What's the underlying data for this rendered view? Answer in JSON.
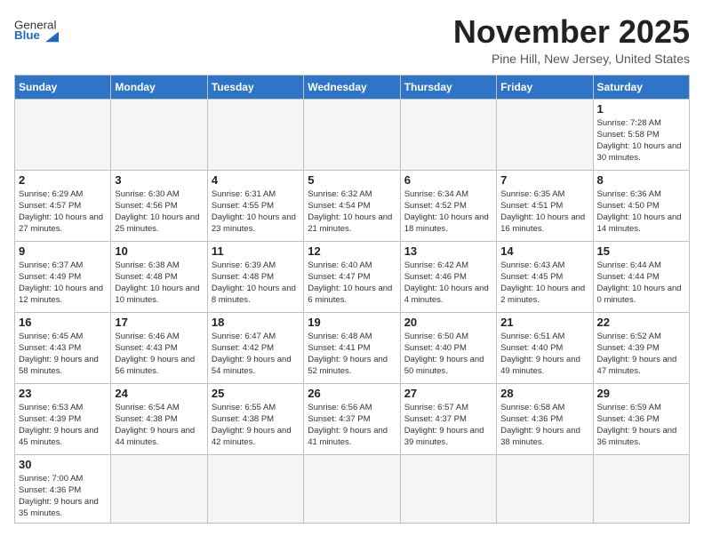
{
  "header": {
    "logo_general": "General",
    "logo_blue": "Blue",
    "title": "November 2025",
    "location": "Pine Hill, New Jersey, United States"
  },
  "days_of_week": [
    "Sunday",
    "Monday",
    "Tuesday",
    "Wednesday",
    "Thursday",
    "Friday",
    "Saturday"
  ],
  "weeks": [
    [
      {
        "day": "",
        "info": ""
      },
      {
        "day": "",
        "info": ""
      },
      {
        "day": "",
        "info": ""
      },
      {
        "day": "",
        "info": ""
      },
      {
        "day": "",
        "info": ""
      },
      {
        "day": "",
        "info": ""
      },
      {
        "day": "1",
        "info": "Sunrise: 7:28 AM\nSunset: 5:58 PM\nDaylight: 10 hours and 30 minutes."
      }
    ],
    [
      {
        "day": "2",
        "info": "Sunrise: 6:29 AM\nSunset: 4:57 PM\nDaylight: 10 hours and 27 minutes."
      },
      {
        "day": "3",
        "info": "Sunrise: 6:30 AM\nSunset: 4:56 PM\nDaylight: 10 hours and 25 minutes."
      },
      {
        "day": "4",
        "info": "Sunrise: 6:31 AM\nSunset: 4:55 PM\nDaylight: 10 hours and 23 minutes."
      },
      {
        "day": "5",
        "info": "Sunrise: 6:32 AM\nSunset: 4:54 PM\nDaylight: 10 hours and 21 minutes."
      },
      {
        "day": "6",
        "info": "Sunrise: 6:34 AM\nSunset: 4:52 PM\nDaylight: 10 hours and 18 minutes."
      },
      {
        "day": "7",
        "info": "Sunrise: 6:35 AM\nSunset: 4:51 PM\nDaylight: 10 hours and 16 minutes."
      },
      {
        "day": "8",
        "info": "Sunrise: 6:36 AM\nSunset: 4:50 PM\nDaylight: 10 hours and 14 minutes."
      }
    ],
    [
      {
        "day": "9",
        "info": "Sunrise: 6:37 AM\nSunset: 4:49 PM\nDaylight: 10 hours and 12 minutes."
      },
      {
        "day": "10",
        "info": "Sunrise: 6:38 AM\nSunset: 4:48 PM\nDaylight: 10 hours and 10 minutes."
      },
      {
        "day": "11",
        "info": "Sunrise: 6:39 AM\nSunset: 4:48 PM\nDaylight: 10 hours and 8 minutes."
      },
      {
        "day": "12",
        "info": "Sunrise: 6:40 AM\nSunset: 4:47 PM\nDaylight: 10 hours and 6 minutes."
      },
      {
        "day": "13",
        "info": "Sunrise: 6:42 AM\nSunset: 4:46 PM\nDaylight: 10 hours and 4 minutes."
      },
      {
        "day": "14",
        "info": "Sunrise: 6:43 AM\nSunset: 4:45 PM\nDaylight: 10 hours and 2 minutes."
      },
      {
        "day": "15",
        "info": "Sunrise: 6:44 AM\nSunset: 4:44 PM\nDaylight: 10 hours and 0 minutes."
      }
    ],
    [
      {
        "day": "16",
        "info": "Sunrise: 6:45 AM\nSunset: 4:43 PM\nDaylight: 9 hours and 58 minutes."
      },
      {
        "day": "17",
        "info": "Sunrise: 6:46 AM\nSunset: 4:43 PM\nDaylight: 9 hours and 56 minutes."
      },
      {
        "day": "18",
        "info": "Sunrise: 6:47 AM\nSunset: 4:42 PM\nDaylight: 9 hours and 54 minutes."
      },
      {
        "day": "19",
        "info": "Sunrise: 6:48 AM\nSunset: 4:41 PM\nDaylight: 9 hours and 52 minutes."
      },
      {
        "day": "20",
        "info": "Sunrise: 6:50 AM\nSunset: 4:40 PM\nDaylight: 9 hours and 50 minutes."
      },
      {
        "day": "21",
        "info": "Sunrise: 6:51 AM\nSunset: 4:40 PM\nDaylight: 9 hours and 49 minutes."
      },
      {
        "day": "22",
        "info": "Sunrise: 6:52 AM\nSunset: 4:39 PM\nDaylight: 9 hours and 47 minutes."
      }
    ],
    [
      {
        "day": "23",
        "info": "Sunrise: 6:53 AM\nSunset: 4:39 PM\nDaylight: 9 hours and 45 minutes."
      },
      {
        "day": "24",
        "info": "Sunrise: 6:54 AM\nSunset: 4:38 PM\nDaylight: 9 hours and 44 minutes."
      },
      {
        "day": "25",
        "info": "Sunrise: 6:55 AM\nSunset: 4:38 PM\nDaylight: 9 hours and 42 minutes."
      },
      {
        "day": "26",
        "info": "Sunrise: 6:56 AM\nSunset: 4:37 PM\nDaylight: 9 hours and 41 minutes."
      },
      {
        "day": "27",
        "info": "Sunrise: 6:57 AM\nSunset: 4:37 PM\nDaylight: 9 hours and 39 minutes."
      },
      {
        "day": "28",
        "info": "Sunrise: 6:58 AM\nSunset: 4:36 PM\nDaylight: 9 hours and 38 minutes."
      },
      {
        "day": "29",
        "info": "Sunrise: 6:59 AM\nSunset: 4:36 PM\nDaylight: 9 hours and 36 minutes."
      }
    ],
    [
      {
        "day": "30",
        "info": "Sunrise: 7:00 AM\nSunset: 4:36 PM\nDaylight: 9 hours and 35 minutes."
      },
      {
        "day": "",
        "info": ""
      },
      {
        "day": "",
        "info": ""
      },
      {
        "day": "",
        "info": ""
      },
      {
        "day": "",
        "info": ""
      },
      {
        "day": "",
        "info": ""
      },
      {
        "day": "",
        "info": ""
      }
    ]
  ]
}
